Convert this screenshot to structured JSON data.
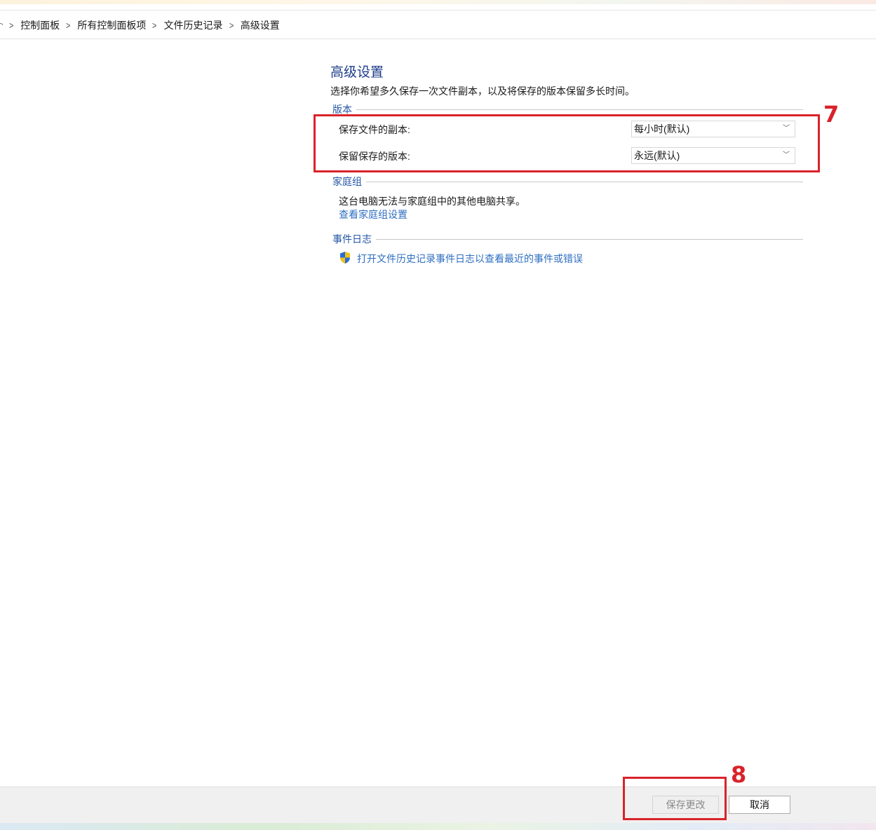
{
  "breadcrumb": {
    "items": [
      "控制面板",
      "所有控制面板项",
      "文件历史记录",
      "高级设置"
    ]
  },
  "page": {
    "title": "高级设置",
    "description": "选择你希望多久保存一次文件副本，以及将保存的版本保留多长时间。"
  },
  "versions": {
    "group_label": "版本",
    "save_copies_label": "保存文件的副本:",
    "save_copies_value": "每小时(默认)",
    "keep_versions_label": "保留保存的版本:",
    "keep_versions_value": "永远(默认)"
  },
  "homegroup": {
    "group_label": "家庭组",
    "status_text": "这台电脑无法与家庭组中的其他电脑共享。",
    "settings_link": "查看家庭组设置"
  },
  "event_log": {
    "group_label": "事件日志",
    "open_link": "打开文件历史记录事件日志以查看最近的事件或错误",
    "icon": "uac-shield-icon"
  },
  "annotations": {
    "marker_7": "7",
    "marker_8": "8",
    "color": "#d9232a"
  },
  "footer": {
    "save_label": "保存更改",
    "cancel_label": "取消"
  }
}
